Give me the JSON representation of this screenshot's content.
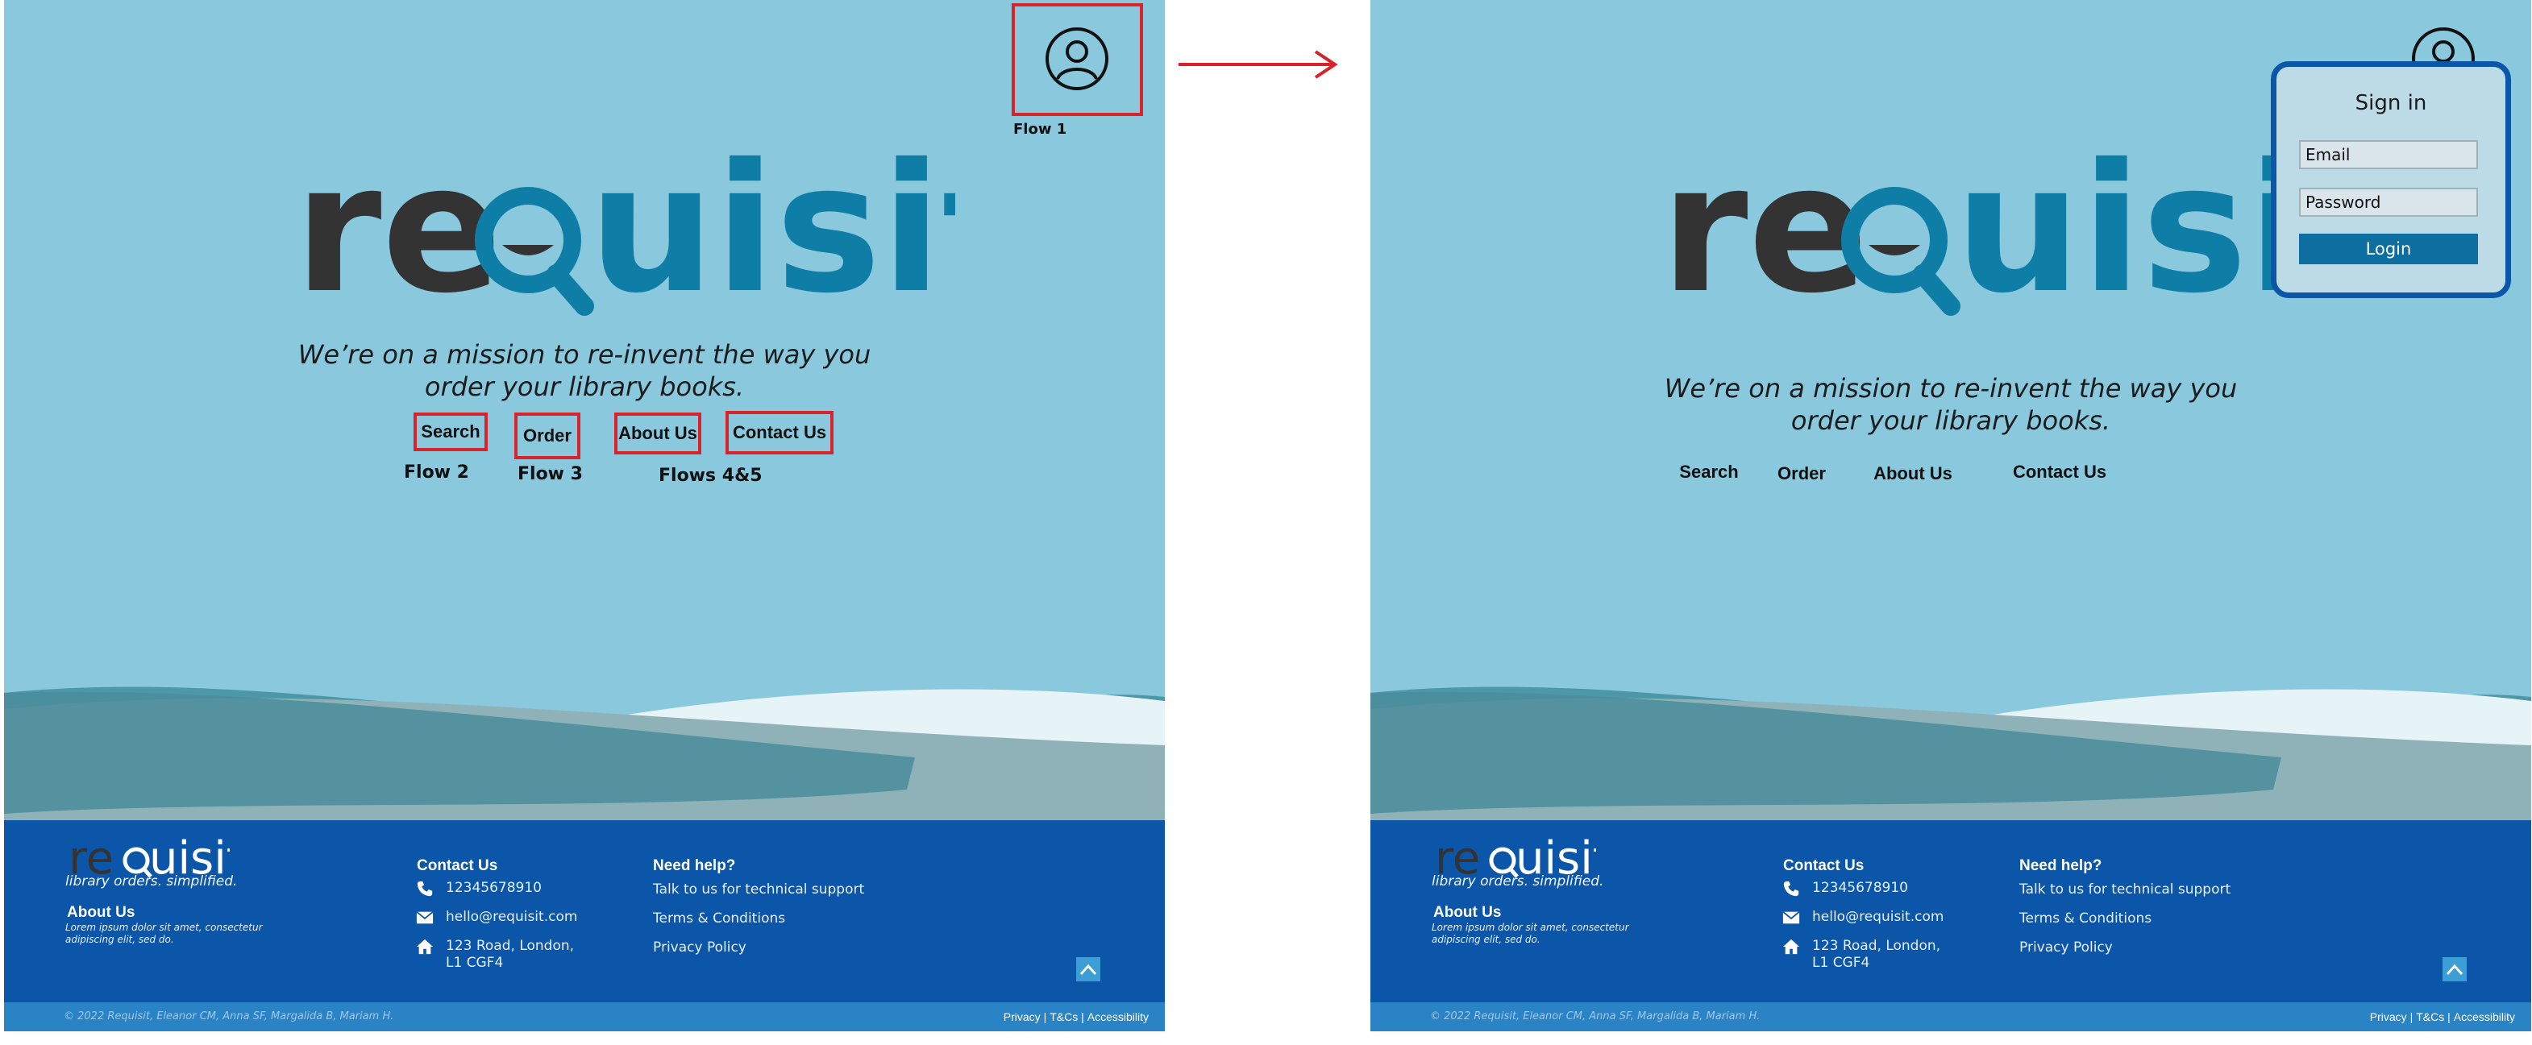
{
  "brand": {
    "logo_text_left": "re",
    "logo_text_right": "quisit",
    "slogan": "library orders. simplified.",
    "color_dark": "#333333",
    "color_teal": "#0f7ea6"
  },
  "tagline": {
    "line1": "We’re on a mission to re-invent the way you",
    "line2": "order your library books."
  },
  "nav": {
    "search": "Search",
    "order": "Order",
    "about": "About Us",
    "contact": "Contact Us"
  },
  "annotations": {
    "flow1": "Flow 1",
    "flow2": "Flow 2",
    "flow3": "Flow 3",
    "flows45": "Flows 4&5",
    "highlight_color": "#d8232a"
  },
  "footer": {
    "about_title": "About Us",
    "about_text": "Lorem ipsum dolor sit amet, consectetur adipiscing elit, sed do.",
    "contact_title": "Contact Us",
    "phone": "12345678910",
    "email": "hello@requisit.com",
    "address_line1": "123 Road, London,",
    "address_line2": "L1 CGF4",
    "help_title": "Need help?",
    "help_links": [
      "Talk to us for technical support",
      "Terms & Conditions",
      "Privacy Policy"
    ],
    "copyright": "© 2022 Requisit, Eleanor CM, Anna SF, Margalida B, Mariam H.",
    "legal": [
      "Privacy |",
      "T&Cs |",
      "Accessibility"
    ]
  },
  "signin": {
    "title": "Sign in",
    "email_placeholder": "Email",
    "password_placeholder": "Password",
    "login_label": "Login"
  },
  "colors": {
    "background": "#89c8dd",
    "footer": "#0b56a8",
    "bottom_bar": "#2a83c4",
    "signin_border": "#0b56a8",
    "login_button": "#0d6fa0"
  },
  "icons": [
    "user-icon",
    "phone-icon",
    "mail-icon",
    "home-icon",
    "chevron-up-icon",
    "arrow-right-icon"
  ]
}
